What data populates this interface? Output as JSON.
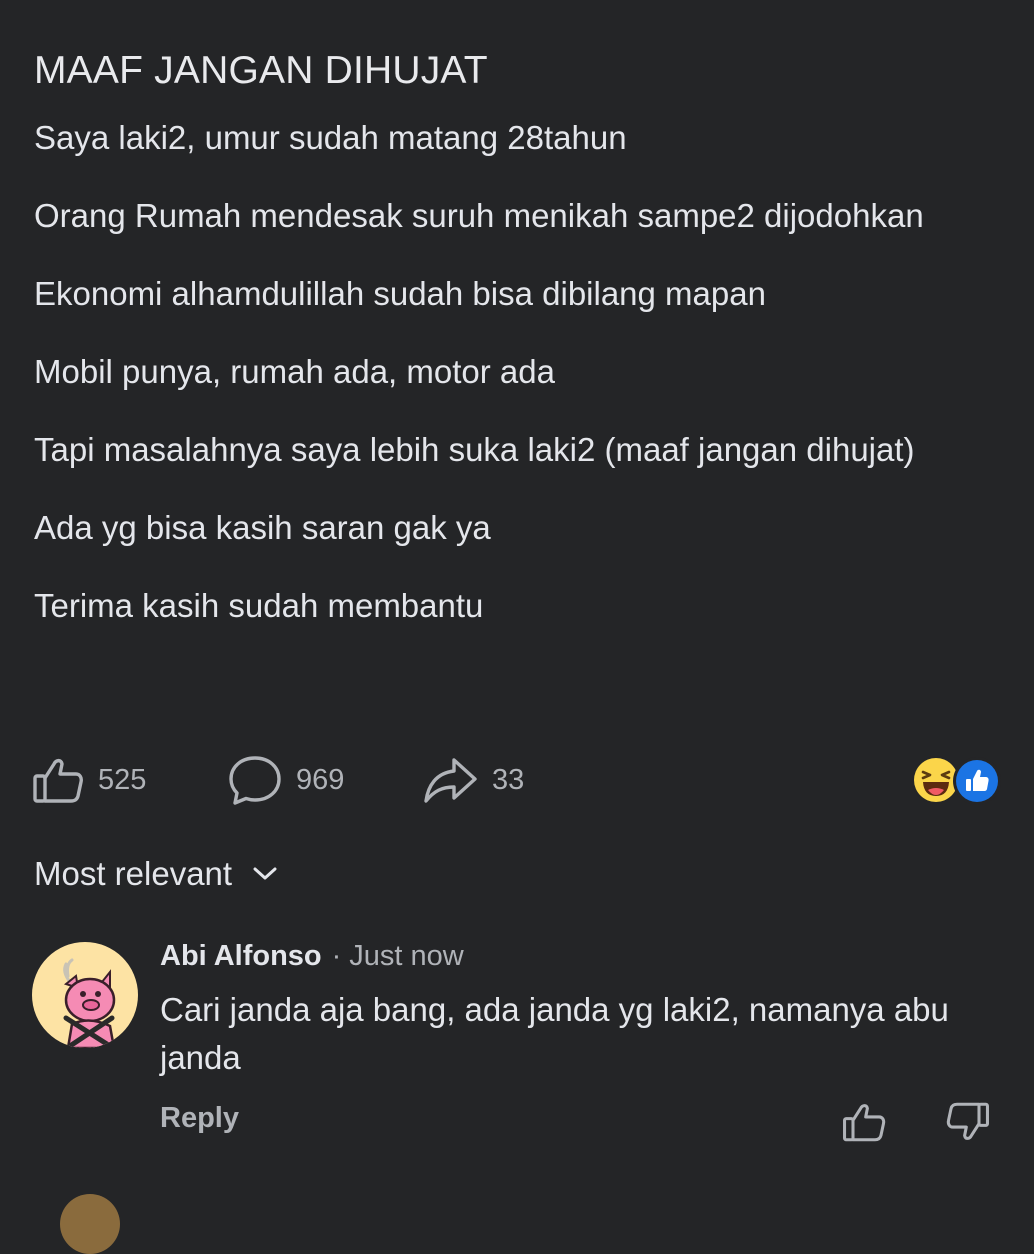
{
  "post": {
    "title": "MAAF JANGAN DIHUJAT",
    "paragraphs": [
      "Saya laki2, umur sudah matang 28tahun",
      "Orang Rumah mendesak suruh menikah sampe2 dijodohkan",
      "Ekonomi alhamdulillah sudah bisa dibilang mapan",
      "Mobil punya, rumah ada, motor ada",
      "Tapi masalahnya saya lebih suka laki2 (maaf jangan dihujat)",
      "Ada yg bisa kasih saran gak ya",
      "Terima kasih sudah membantu"
    ]
  },
  "actions": {
    "like_count": "525",
    "comment_count": "969",
    "share_count": "33",
    "like_icon": "thumbs-up-icon",
    "comment_icon": "speech-bubble-icon",
    "share_icon": "share-arrow-icon",
    "reactions": [
      "haha",
      "like"
    ]
  },
  "sort": {
    "label": "Most relevant",
    "icon": "chevron-down-icon"
  },
  "comment": {
    "author": "Abi Alfonso",
    "separator": "·",
    "time": "Just now",
    "text": "Cari janda aja bang, ada janda yg laki2, namanya abu janda",
    "reply_label": "Reply"
  },
  "colors": {
    "background": "#242527",
    "text_primary": "#e4e6eb",
    "text_secondary": "#b0b3b8",
    "like_blue": "#1b74e4",
    "haha_yellow": "#fbd54a"
  }
}
